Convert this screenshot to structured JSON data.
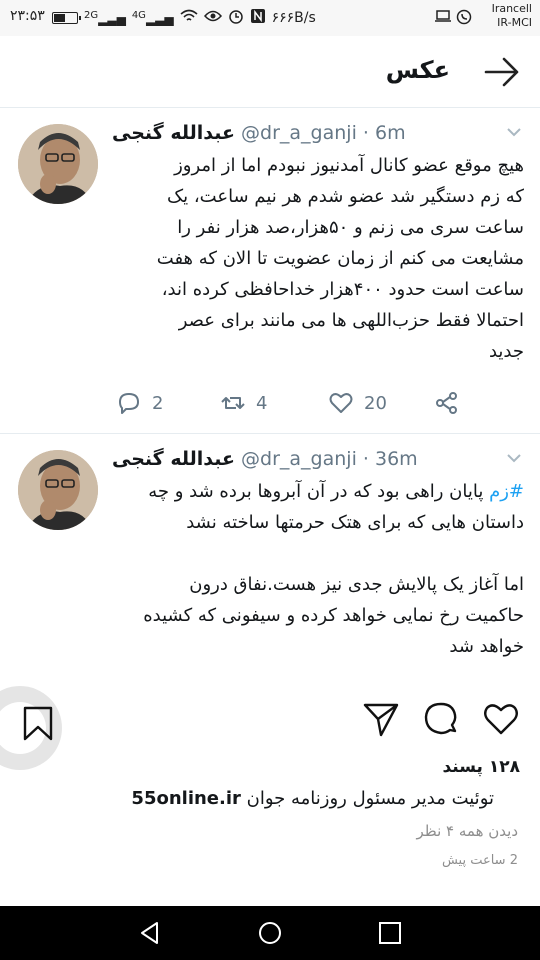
{
  "status_bar": {
    "time": "۲۳:۵۳",
    "network_1": "2G",
    "network_2": "4G",
    "speed": "۶۶۶B/s",
    "carrier_1": "Irancell",
    "carrier_2": "IR-MCI",
    "battery_level": 0.5
  },
  "header": {
    "title": "عکس",
    "back_icon": "arrow-right-icon"
  },
  "tweets": [
    {
      "display_name": "عبدالله گنجی",
      "handle": "@dr_a_ganji",
      "time": "· 6m",
      "text": "هیچ موقع عضو کانال آمدنیوز نبودم اما از امروز\nکه زم دستگیر شد عضو شدم هر نیم ساعت، یک\nساعت سری می زنم و ۵۰هزار،صد هزار نفر را\nمشایعت می کنم از زمان عضویت تا الان که هفت\nساعت است حدود ۴۰۰هزار خداحافظی کرده اند،\nاحتمالا فقط حزب‌اللهی ها می مانند برای عصر\nجدید",
      "replies": "2",
      "retweets": "4",
      "likes": "20"
    },
    {
      "display_name": "عبدالله گنجی",
      "handle": "@dr_a_ganji",
      "time": "· 36m",
      "hashtag": "#زم",
      "text_after_hashtag": " پایان راهی بود که در آن آبروها برده شد و چه\nداستان هایی که برای هتک حرمتها ساخته نشد\n\nاما آغاز یک پالایش جدی نیز هست.نفاق درون\nحاکمیت رخ نمایی خواهد کرده و سیفونی که کشیده\nخواهد شد"
    }
  ],
  "instagram": {
    "likes": "۱۲۸ پسند",
    "caption_site": "55online.ir",
    "caption_text": "توئیت مدیر مسئول روزنامه جوان",
    "views": "دیدن همه ۴ نظر",
    "time_ago": "2 ساعت پیش"
  },
  "colors": {
    "accent": "#1da1f2",
    "muted": "#657786",
    "text": "#14171a"
  }
}
